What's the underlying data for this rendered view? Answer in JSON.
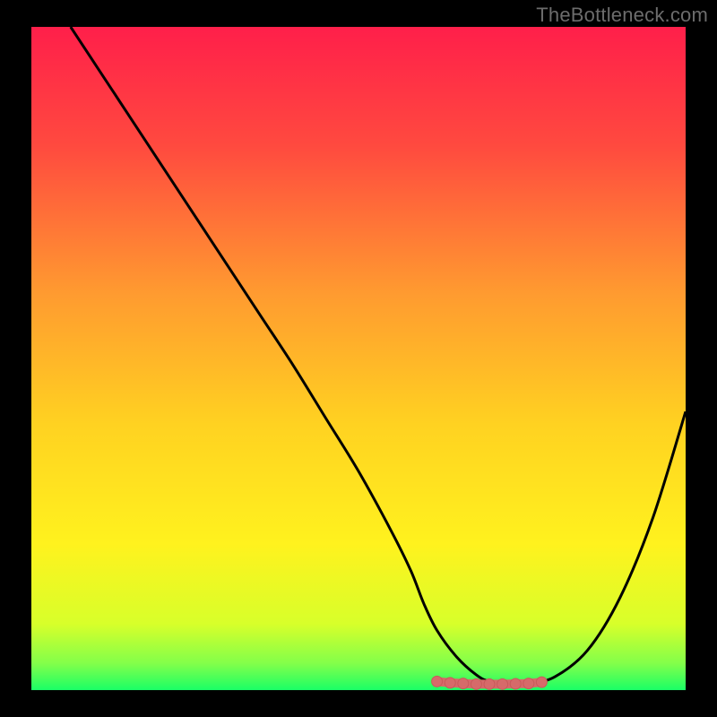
{
  "watermark": "TheBottleneck.com",
  "colors": {
    "bg": "#000000",
    "gradient_stops": [
      {
        "offset": 0.0,
        "color": "#ff1f4a"
      },
      {
        "offset": 0.18,
        "color": "#ff4a3f"
      },
      {
        "offset": 0.4,
        "color": "#ff9a30"
      },
      {
        "offset": 0.6,
        "color": "#ffd221"
      },
      {
        "offset": 0.78,
        "color": "#fff21e"
      },
      {
        "offset": 0.9,
        "color": "#d8ff2a"
      },
      {
        "offset": 0.96,
        "color": "#82ff4a"
      },
      {
        "offset": 1.0,
        "color": "#1aff66"
      }
    ],
    "curve": "#000000",
    "marker_fill": "#d66a6a",
    "marker_stroke": "#c85a5a"
  },
  "chart_data": {
    "type": "line",
    "title": "",
    "xlabel": "",
    "ylabel": "",
    "xlim": [
      0,
      100
    ],
    "ylim": [
      0,
      100
    ],
    "series": [
      {
        "name": "curve",
        "x": [
          6,
          10,
          15,
          20,
          25,
          30,
          35,
          40,
          45,
          50,
          55,
          58,
          60,
          62,
          65,
          68,
          70,
          73,
          76,
          80,
          85,
          90,
          95,
          100
        ],
        "y": [
          100,
          94,
          86.5,
          79,
          71.5,
          64,
          56.5,
          49,
          41,
          33,
          24,
          18,
          13,
          9,
          5,
          2.3,
          1.3,
          0.9,
          1.0,
          2.0,
          6,
          14,
          26,
          42
        ]
      }
    ],
    "markers": {
      "name": "flat-region",
      "x": [
        62,
        64,
        66,
        68,
        70,
        72,
        74,
        76,
        78
      ],
      "y": [
        1.3,
        1.1,
        1.0,
        0.9,
        0.9,
        0.9,
        0.95,
        1.0,
        1.2
      ]
    }
  }
}
